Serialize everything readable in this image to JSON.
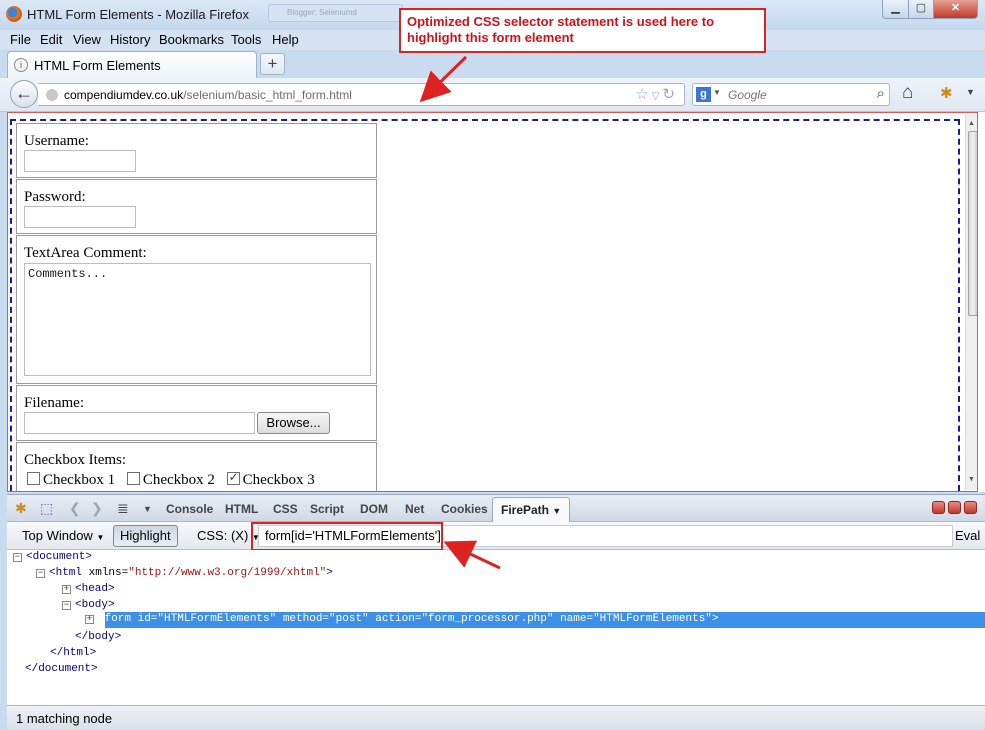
{
  "window": {
    "title": "HTML Form Elements - Mozilla Firefox",
    "background_tab": "Blogger: Seleniumd"
  },
  "menu": [
    "File",
    "Edit",
    "View",
    "History",
    "Bookmarks",
    "Tools",
    "Help"
  ],
  "tab": {
    "label": "HTML Form Elements",
    "new_tab": "+"
  },
  "nav": {
    "url_host": "compendiumdev.co.uk",
    "url_path": "/selenium/basic_html_form.html",
    "search_engine": "g",
    "search_placeholder": "Google"
  },
  "form": {
    "username_label": "Username:",
    "password_label": "Password:",
    "textarea_label": "TextArea Comment:",
    "textarea_value": "Comments...",
    "filename_label": "Filename:",
    "browse_label": "Browse...",
    "checkbox_label": "Checkbox Items:",
    "checkboxes": [
      {
        "label": "Checkbox 1",
        "checked": false
      },
      {
        "label": "Checkbox 2",
        "checked": false
      },
      {
        "label": "Checkbox 3",
        "checked": true
      }
    ]
  },
  "annotations": {
    "callout": "Optimized CSS selector statement is used here to highlight this form element"
  },
  "firebug": {
    "tabs": [
      "Console",
      "HTML",
      "CSS",
      "Script",
      "DOM",
      "Net",
      "Cookies",
      "FirePath"
    ],
    "active_tab": "FirePath",
    "top_window": "Top Window",
    "highlight": "Highlight",
    "css_label": "CSS: (X)",
    "selector": "form[id='HTMLFormElements']",
    "eval": "Eval",
    "tree": {
      "document_open": "<document>",
      "html_open_tag": "<html",
      "html_attr": "xmlns=",
      "html_val": "\"http://www.w3.org/1999/xhtml\"",
      "html_close_bracket": ">",
      "head": "<head>",
      "body_open": "<body>",
      "form_line": "<form id=\"HTMLFormElements\" method=\"post\" action=\"form_processor.php\" name=\"HTMLFormElements\">",
      "body_close": "</body>",
      "html_close": "</html>",
      "document_close": "</document>"
    },
    "status": "1 matching node"
  },
  "colors": {
    "annotation_red": "#d22222",
    "selection_blue": "#3d8fe8",
    "highlight_dash": "#1a1aa0"
  }
}
